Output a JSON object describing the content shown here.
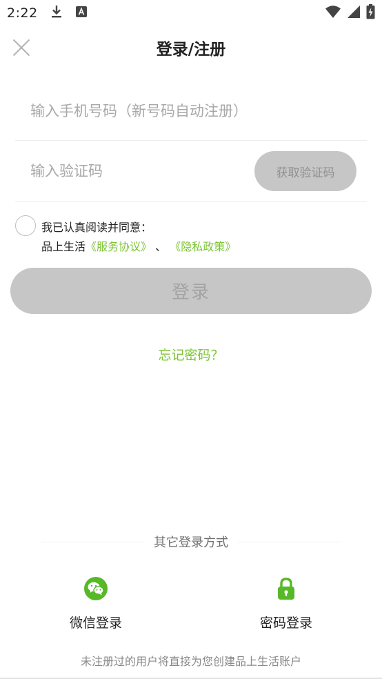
{
  "status_bar": {
    "time": "2:22"
  },
  "header": {
    "title": "登录/注册"
  },
  "form": {
    "phone_placeholder": "输入手机号码（新号码自动注册）",
    "code_placeholder": "输入验证码",
    "get_code_label": "获取验证码"
  },
  "agreement": {
    "line1": "我已认真阅读并同意：",
    "prefix": "品上生活",
    "service_link": "《服务协议》",
    "separator": "、",
    "privacy_link": "《隐私政策》"
  },
  "login_button": "登录",
  "forgot_password": "忘记密码？",
  "other_login": {
    "title": "其它登录方式",
    "methods": [
      {
        "label": "微信登录",
        "icon": "wechat-icon"
      },
      {
        "label": "密码登录",
        "icon": "lock-icon"
      }
    ]
  },
  "footer_note": "未注册过的用户将直接为您创建品上生活账户",
  "colors": {
    "accent": "#7cc433",
    "disabled_button": "#c6c6c6",
    "wechat": "#57b828"
  }
}
